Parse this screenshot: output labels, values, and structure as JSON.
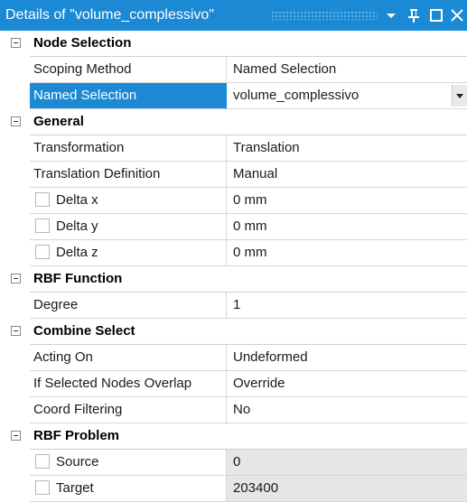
{
  "titlebar": {
    "title": "Details of \"volume_complessivo\"",
    "icons": [
      "dropdown-arrow",
      "pin",
      "maximize",
      "close"
    ]
  },
  "sections": [
    {
      "name": "Node Selection",
      "rows": [
        {
          "label": "Scoping Method",
          "value": "Named Selection"
        },
        {
          "label": "Named Selection",
          "value": "volume_complessivo",
          "selected": true,
          "dropdown": true
        }
      ]
    },
    {
      "name": "General",
      "rows": [
        {
          "label": "Transformation",
          "value": "Translation"
        },
        {
          "label": "Translation Definition",
          "value": "Manual"
        },
        {
          "label": "Delta x",
          "value": "0 mm",
          "checkbox": true
        },
        {
          "label": "Delta y",
          "value": "0 mm",
          "checkbox": true
        },
        {
          "label": "Delta z",
          "value": "0 mm",
          "checkbox": true
        }
      ]
    },
    {
      "name": "RBF Function",
      "rows": [
        {
          "label": "Degree",
          "value": "1"
        }
      ]
    },
    {
      "name": "Combine Select",
      "rows": [
        {
          "label": "Acting On",
          "value": "Undeformed"
        },
        {
          "label": "If Selected Nodes Overlap",
          "value": "Override"
        },
        {
          "label": "Coord Filtering",
          "value": "No"
        }
      ]
    },
    {
      "name": "RBF Problem",
      "rows": [
        {
          "label": "Source",
          "value": "0",
          "checkbox": true,
          "readonly": true
        },
        {
          "label": "Target",
          "value": "203400",
          "checkbox": true,
          "readonly": true
        }
      ]
    }
  ],
  "colors": {
    "accent": "#1b89d4",
    "readonly_bg": "#e6e6e6",
    "gridline": "#d7d7d7"
  }
}
